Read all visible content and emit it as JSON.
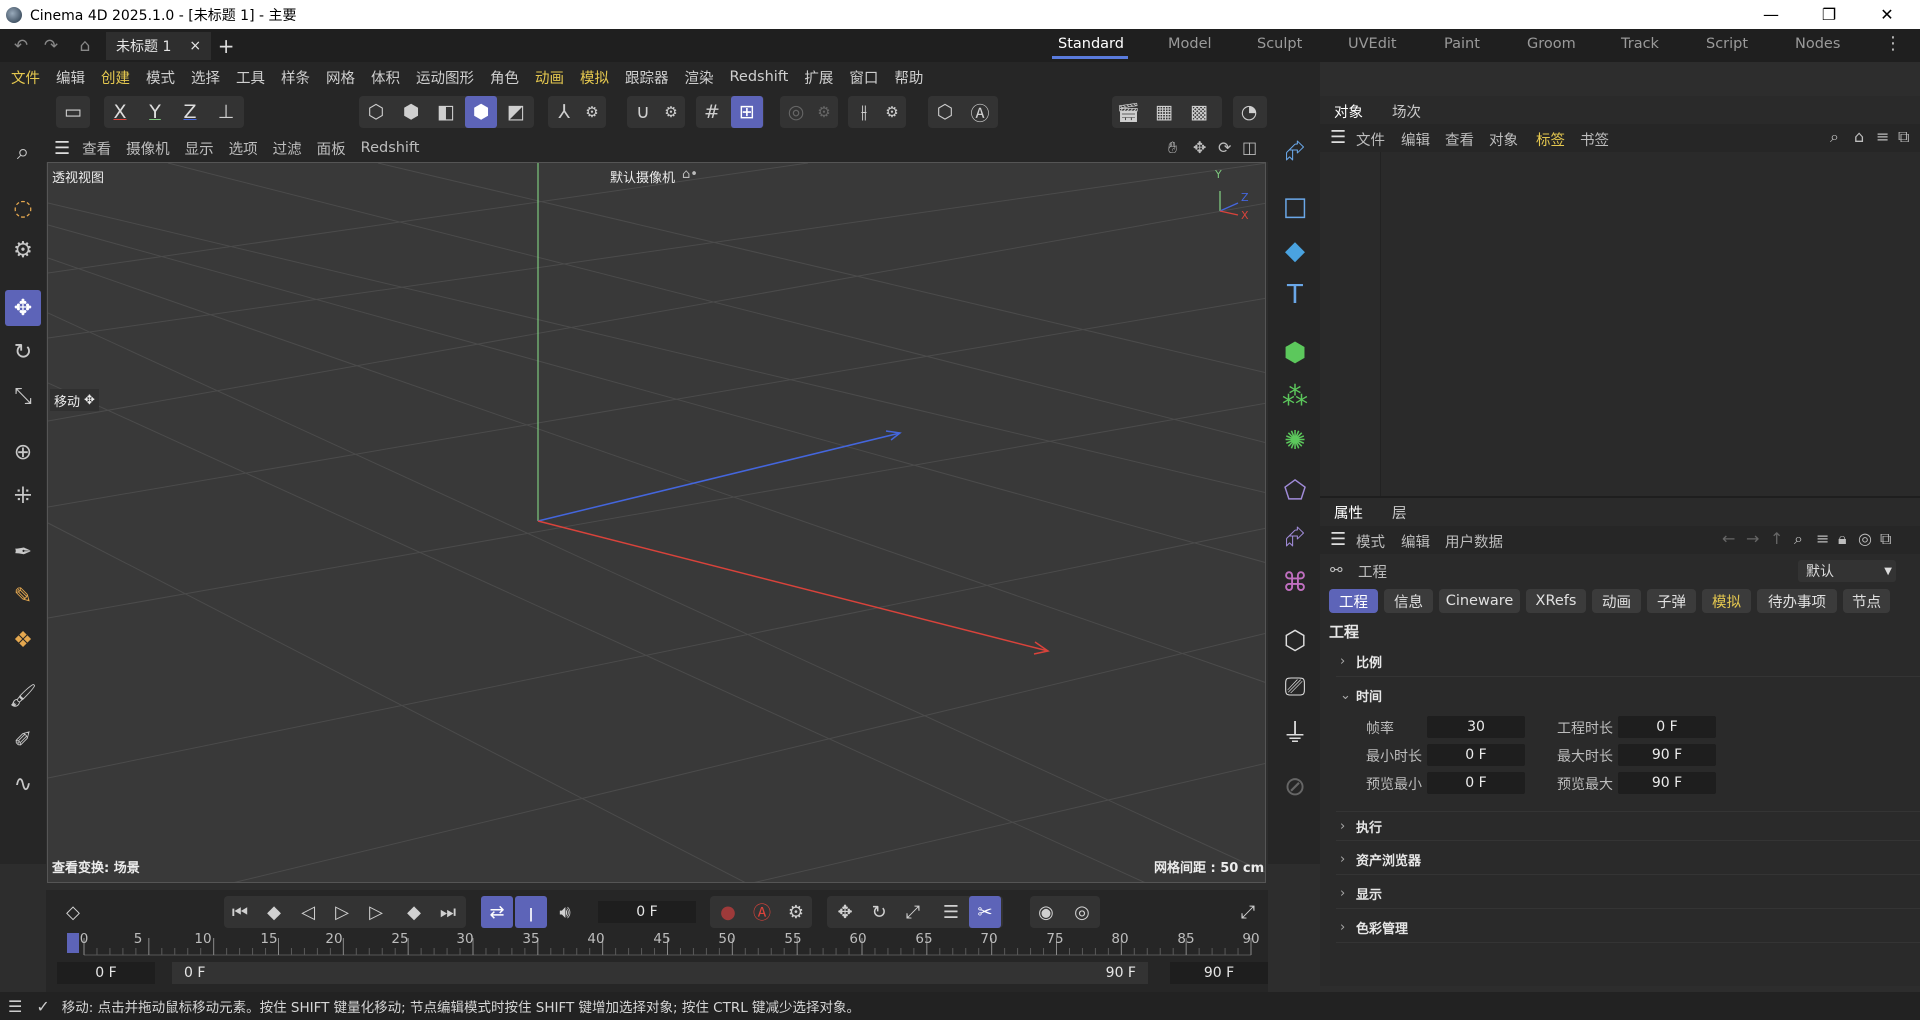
{
  "window": {
    "title": "Cinema 4D 2025.1.0 - [未标题 1] - 主要",
    "minimize": "—",
    "maximize": "❐",
    "close": "✕"
  },
  "tabbar": {
    "doc_tab": "未标题 1",
    "doc_close": "×",
    "add_tab": "+",
    "layouts": [
      "Standard",
      "Model",
      "Sculpt",
      "UVEdit",
      "Paint",
      "Groom",
      "Track",
      "Script",
      "Nodes"
    ],
    "active_layout": "Standard",
    "more": "⋮"
  },
  "menubar": {
    "items": [
      "文件",
      "编辑",
      "创建",
      "模式",
      "选择",
      "工具",
      "样条",
      "网格",
      "体积",
      "运动图形",
      "角色",
      "动画",
      "模拟",
      "跟踪器",
      "渲染",
      "Redshift",
      "扩展",
      "窗口",
      "帮助"
    ],
    "highlighted": [
      "文件",
      "创建",
      "动画",
      "模拟"
    ]
  },
  "toolbar": {
    "axis_x": "X",
    "axis_y": "Y",
    "axis_z": "Z"
  },
  "viewport_menu": {
    "items": [
      "查看",
      "摄像机",
      "显示",
      "选项",
      "过滤",
      "面板",
      "Redshift"
    ]
  },
  "viewport": {
    "view_name": "透视视图",
    "camera": "默认摄像机",
    "camera_icon": "⌂•",
    "hud_move": "移动",
    "hud_move_icon": "✥",
    "transform_info": "查看变换: 场景",
    "grid_spacing": "网格间距 : 50 cm",
    "axis_labels": {
      "y": "Y",
      "z": "Z",
      "x": "X"
    }
  },
  "colors": {
    "accent": "#5d64b8",
    "highlight_text": "#e5c84f",
    "axis_x": "#d9433b",
    "axis_y": "#7ec87e",
    "axis_z": "#4466dd"
  },
  "object_panel": {
    "tabs": [
      "对象",
      "场次"
    ],
    "active_tab": "对象",
    "menu": [
      "文件",
      "编辑",
      "查看",
      "对象",
      "标签",
      "书签"
    ],
    "highlighted": "标签"
  },
  "attributes_panel": {
    "tabs": [
      "属性",
      "层"
    ],
    "active_tab": "属性",
    "menu": [
      "模式",
      "编辑",
      "用户数据"
    ],
    "object_label": "工程",
    "preset": "默认",
    "chips": [
      "工程",
      "信息",
      "Cineware",
      "XRefs",
      "动画",
      "子弹",
      "模拟",
      "待办事项",
      "节点"
    ],
    "active_chip": "工程",
    "highlighted_chip": "模拟",
    "section_title": "工程",
    "sections": {
      "scale": "比例",
      "time": "时间",
      "execute": "执行",
      "asset_browser": "资产浏览器",
      "display": "显示",
      "color_mgmt": "色彩管理"
    },
    "time_fields": {
      "fps_label": "帧率",
      "fps": "30",
      "project_length_label": "工程时长",
      "project_length": "0 F",
      "min_length_label": "最小时长",
      "min_length": "0 F",
      "max_length_label": "最大时长",
      "max_length": "90 F",
      "preview_min_label": "预览最小",
      "preview_min": "0 F",
      "preview_max_label": "预览最大",
      "preview_max": "90 F"
    }
  },
  "timeline": {
    "current_frame": "0 F",
    "ticks": [
      "0",
      "5",
      "10",
      "15",
      "20",
      "25",
      "30",
      "35",
      "40",
      "45",
      "50",
      "55",
      "60",
      "65",
      "70",
      "75",
      "80",
      "85",
      "90"
    ],
    "start_frame": "0 F",
    "range_start": "0 F",
    "range_end": "90 F",
    "end_frame": "90 F"
  },
  "status": {
    "text": "移动: 点击并拖动鼠标移动元素。按住 SHIFT 键量化移动; 节点编辑模式时按住 SHIFT 键增加选择对象; 按住 CTRL 键减少选择对象。"
  }
}
